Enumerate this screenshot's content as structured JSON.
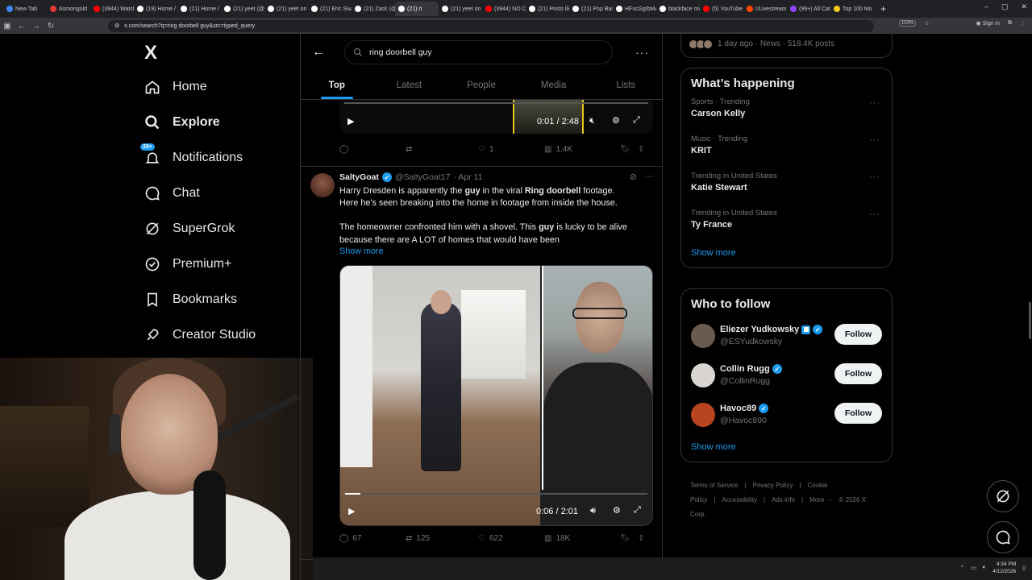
{
  "browser": {
    "tabs": [
      {
        "label": "New Tab",
        "color": "#4285f4"
      },
      {
        "label": "Asmongold",
        "color": "#e53935"
      },
      {
        "label": "(3944) Watch",
        "color": "#ff0000"
      },
      {
        "label": "(19) Home /",
        "color": "#ffffff"
      },
      {
        "label": "(21) Home /",
        "color": "#ffffff"
      },
      {
        "label": "(21) yeet (@",
        "color": "#ffffff"
      },
      {
        "label": "(21) yeet on",
        "color": "#ffffff"
      },
      {
        "label": "(21) Eric Swa",
        "color": "#ffffff"
      },
      {
        "label": "(21) Zack (@",
        "color": "#ffffff"
      },
      {
        "label": "(21) ri",
        "color": "#ffffff",
        "active": true
      },
      {
        "label": "(21) yeet on",
        "color": "#ffffff"
      },
      {
        "label": "(3944) NO CH",
        "color": "#ff0000"
      },
      {
        "label": "(21) Posts lik",
        "color": "#ffffff"
      },
      {
        "label": "(21) Pop Bas",
        "color": "#ffffff"
      },
      {
        "label": "HFscGgIbMA",
        "color": "#ffffff"
      },
      {
        "label": "blackface mi",
        "color": "#ffffff"
      },
      {
        "label": "(5) YouTube",
        "color": "#ff0000"
      },
      {
        "label": "r/Livestream",
        "color": "#ff4500"
      },
      {
        "label": "(99+) All Cat",
        "color": "#9146ff"
      },
      {
        "label": "Top 100 Mo",
        "color": "#f5c518"
      }
    ],
    "url": "x.com/search?q=ring doorbell guy&src=typed_query",
    "zoom": "150%",
    "signin": "Sign in"
  },
  "sidebar": {
    "logo": "X",
    "items": [
      {
        "label": "Home",
        "icon": "home-icon"
      },
      {
        "label": "Explore",
        "icon": "search-icon",
        "bold": true
      },
      {
        "label": "Notifications",
        "icon": "bell-icon",
        "badge": "20+"
      },
      {
        "label": "Chat",
        "icon": "chat-icon"
      },
      {
        "label": "SuperGrok",
        "icon": "grok-icon"
      },
      {
        "label": "Premium+",
        "icon": "premium-icon"
      },
      {
        "label": "Bookmarks",
        "icon": "bookmark-icon"
      },
      {
        "label": "Creator Studio",
        "icon": "rocket-icon"
      }
    ]
  },
  "search": {
    "query": "ring doorbell guy",
    "tabs": [
      "Top",
      "Latest",
      "People",
      "Media",
      "Lists"
    ],
    "active_tab": "Top"
  },
  "post1": {
    "video_time": "0:01 / 2:48",
    "replies": "",
    "reposts": "",
    "likes": "1",
    "views": "1.4K"
  },
  "post2": {
    "name": "SaltyGoat",
    "handle": "@SaltyGoat17",
    "date": "· Apr 11",
    "line1_a": "Harry Dresden is apparently the ",
    "line1_b": "guy",
    "line1_c": " in the viral ",
    "line1_d": "Ring doorbell",
    "line1_e": " footage.",
    "line2": "Here he's seen breaking into the home in footage from inside the house.",
    "line3_a": "The homeowner confronted him with a shovel.  This ",
    "line3_b": "guy",
    "line3_c": " is lucky to be alive",
    "line4": "because there are A LOT of homes that would have been",
    "show_more": "Show more",
    "video_time": "0:06 / 2:01",
    "video_progress": 0.05,
    "replies": "67",
    "reposts": "125",
    "likes": "622",
    "views": "18K"
  },
  "right": {
    "prev_news": "1 day ago · News · 518.4K posts",
    "happening_title": "What’s happening",
    "trends": [
      {
        "category": "Sports · Trending",
        "name": "Carson Kelly"
      },
      {
        "category": "Music · Trending",
        "name": "KRIT"
      },
      {
        "category": "Trending in United States",
        "name": "Katie Stewart"
      },
      {
        "category": "Trending in United States",
        "name": "Ty France"
      }
    ],
    "show_more": "Show more",
    "wtf_title": "Who to follow",
    "follow_label": "Follow",
    "accounts": [
      {
        "name": "Eliezer Yudkowsky",
        "handle": "@ESYudkowsky",
        "avatar_color": "#6b5a4e",
        "org_badge": true
      },
      {
        "name": "Collin Rugg",
        "handle": "@CollinRugg",
        "avatar_color": "#d9d6d2",
        "org_badge": false
      },
      {
        "name": "Havoc89",
        "handle": "@Havoc890",
        "avatar_color": "#b8451f",
        "org_badge": false
      }
    ],
    "wtf_show_more": "Show more",
    "legal": [
      "Terms of Service",
      "|",
      "Privacy Policy",
      "|",
      "Cookie Policy",
      "|",
      "Accessibility",
      "|",
      "Ads info",
      "|",
      "More ···",
      "© 2026 X Corp."
    ]
  },
  "taskbar": {
    "time": "4:34 PM",
    "date": "4/12/2026"
  },
  "colors": {
    "accent": "#1d9bf0",
    "muted": "#71767b",
    "border": "#2f3336"
  }
}
